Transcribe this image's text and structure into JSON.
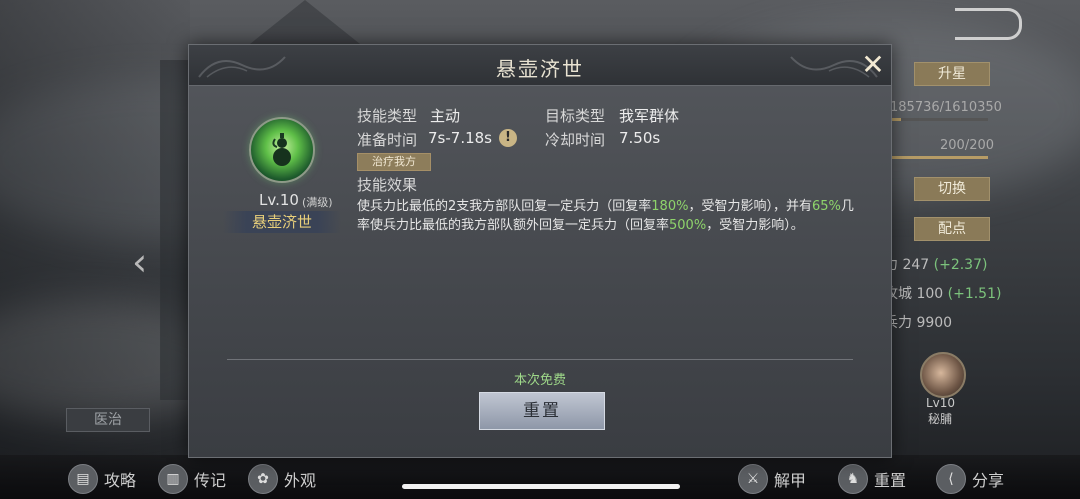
{
  "dialog": {
    "title": "悬壶济世",
    "close_icon": "close-x-icon",
    "skill": {
      "icon": "gourd-skill-icon",
      "level": "Lv.10",
      "max_label": "(满级)",
      "name": "悬壶济世"
    },
    "info": {
      "type_label": "技能类型",
      "type_value": "主动",
      "target_label": "目标类型",
      "target_value": "我军群体",
      "prep_label": "准备时间",
      "prep_value": "7s-7.18s",
      "cooldown_label": "冷却时间",
      "cooldown_value": "7.50s",
      "tag": "治疗我方",
      "effect_label": "技能效果"
    },
    "description": {
      "p1": "使兵力比最低的2支我方部队回复一定兵力（回复率",
      "v1": "180%",
      "p2": "，受智力影响），并有",
      "v2": "65%",
      "p3": "几率使兵力比最低的我方部队额外回复一定兵力（回复率",
      "v3": "500%",
      "p4": "，受智力影响）。"
    },
    "free_text": "本次免费",
    "reset_label": "重置"
  },
  "background": {
    "left_button": "医治",
    "right_panel": {
      "star_button": "升星",
      "xp": "185736/1610350",
      "xp_fraction": 0.115,
      "energy": "200/200",
      "energy_fraction": 1.0,
      "switch_button": "切换",
      "points_button": "配点",
      "stat1": "力 247",
      "stat1_plus": "(+2.37)",
      "stat2": "攻城 100",
      "stat2_plus": "(+1.51)",
      "stat3": "兵力 9900",
      "companion_level": "Lv10",
      "companion_name": "秘脯"
    }
  },
  "bottom_bar": {
    "items": [
      "攻略",
      "传记",
      "外观",
      "解甲",
      "重置",
      "分享"
    ]
  }
}
